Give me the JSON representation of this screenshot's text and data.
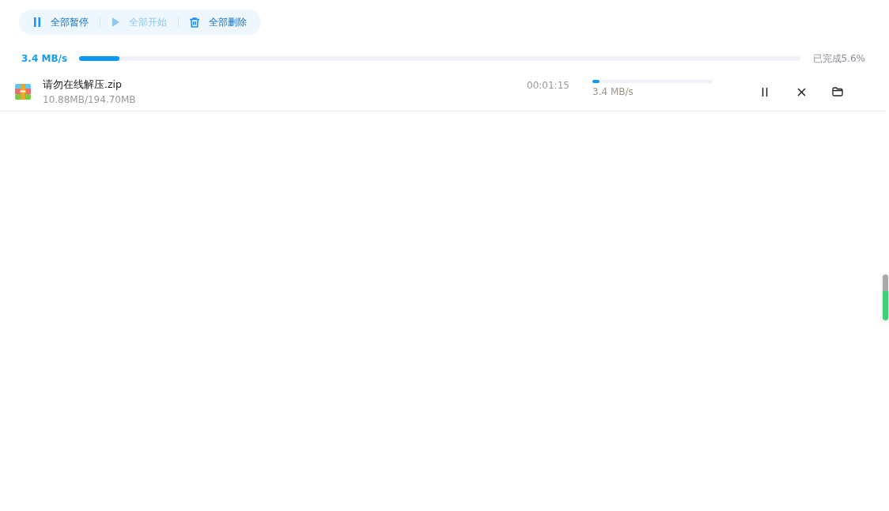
{
  "toolbar": [
    {
      "kind": "pause",
      "label": "全部暂停",
      "disabled": false
    },
    {
      "kind": "start",
      "label": "全部开始",
      "disabled": true
    },
    {
      "kind": "delete",
      "label": "全部删除",
      "disabled": false
    }
  ],
  "summary": {
    "speed": "3.4 MB/s",
    "level": 0.056,
    "status": "已完成5.6%"
  },
  "downloads": [
    {
      "name": "请勿在线解压.zip",
      "size": "10.88MB/194.70MB",
      "remaining": "00:01:15",
      "level": 0.056,
      "speed": "3.4 MB/s"
    }
  ]
}
